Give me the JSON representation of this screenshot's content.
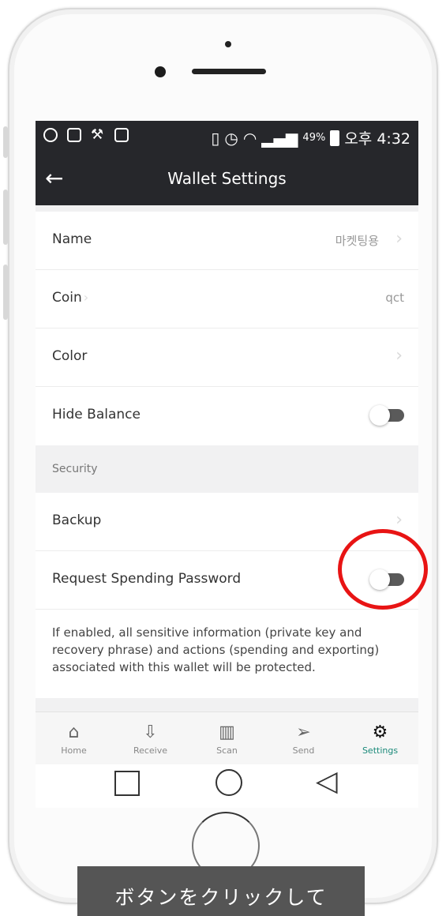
{
  "status_bar": {
    "battery_percent": "49%",
    "time": "오후 4:32",
    "icons": [
      "notification-icon",
      "facebook-icon",
      "wrench-icon",
      "image-icon",
      "vibrate-icon",
      "alarm-icon",
      "wifi-icon",
      "signal-icon",
      "battery-icon"
    ]
  },
  "header": {
    "back_icon": "←",
    "title": "Wallet Settings"
  },
  "settings": {
    "name": {
      "label": "Name",
      "value": "마켓팅용"
    },
    "coin": {
      "label": "Coin",
      "value": "qct"
    },
    "color": {
      "label": "Color"
    },
    "hide_balance": {
      "label": "Hide Balance",
      "enabled": false
    },
    "security_header": "Security",
    "backup": {
      "label": "Backup"
    },
    "request_password": {
      "label": "Request Spending Password",
      "enabled": false
    },
    "note": "If enabled, all sensitive information (private key and recovery phrase) and actions (spending and exporting) associated with this wallet will be protected."
  },
  "tabs": [
    {
      "label": "Home",
      "icon": "home-icon",
      "glyph": "⌂"
    },
    {
      "label": "Receive",
      "icon": "receive-icon",
      "glyph": "⇩"
    },
    {
      "label": "Scan",
      "icon": "scan-icon",
      "glyph": "▥"
    },
    {
      "label": "Send",
      "icon": "send-icon",
      "glyph": "➢"
    },
    {
      "label": "Settings",
      "icon": "settings-icon",
      "glyph": "⚙",
      "active": true
    }
  ],
  "caption": "ボタンをクリックして",
  "colors": {
    "header_bg": "#26272b",
    "active_tab": "#1b8a7a",
    "highlight": "#e81414",
    "caption_bg": "#555555"
  }
}
